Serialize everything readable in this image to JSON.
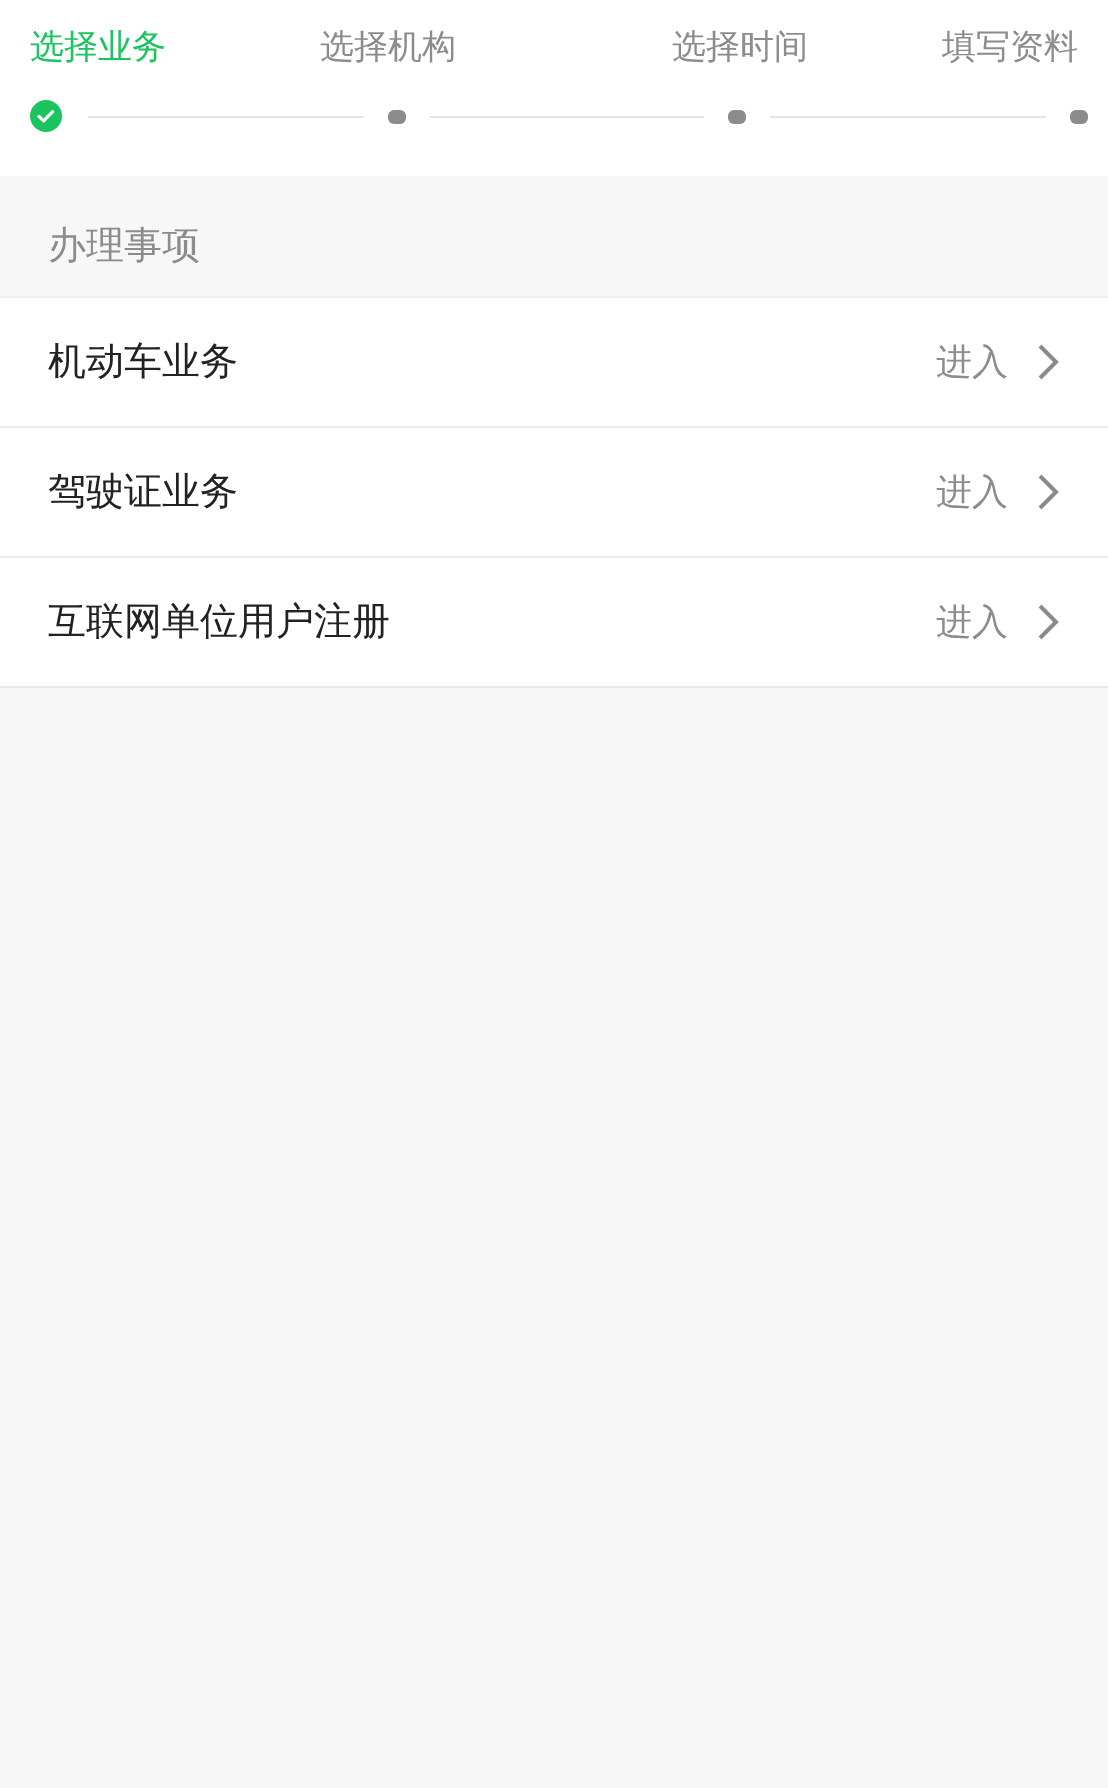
{
  "steps": [
    {
      "label": "选择业务",
      "done": true
    },
    {
      "label": "选择机构",
      "done": false
    },
    {
      "label": "选择时间",
      "done": false
    },
    {
      "label": "填写资料",
      "done": false
    }
  ],
  "section": {
    "title": "办理事项"
  },
  "items": [
    {
      "label": "机动车业务",
      "action": "进入"
    },
    {
      "label": "驾驶证业务",
      "action": "进入"
    },
    {
      "label": "互联网单位用户注册",
      "action": "进入"
    }
  ]
}
